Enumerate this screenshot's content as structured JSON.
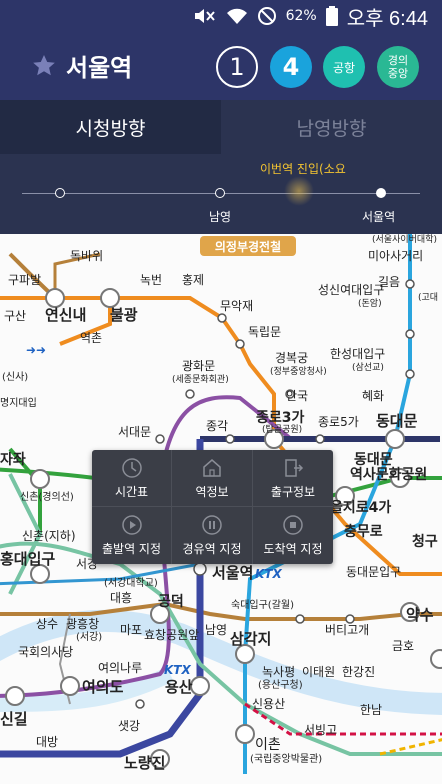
{
  "status_bar": {
    "battery": "62%",
    "time": "오후 6:44",
    "icons": [
      "mute-icon",
      "wifi-icon",
      "do-not-disturb-icon",
      "battery-icon"
    ]
  },
  "header": {
    "station": "서울역",
    "favorite_icon": "star-icon",
    "lines": [
      {
        "label": "1",
        "color": "#2d3568"
      },
      {
        "label": "4",
        "color": "#1aa3dc"
      },
      {
        "label": "공항",
        "color": "#1fc0b0"
      },
      {
        "label": "경의중앙",
        "color": "#2ab894"
      }
    ]
  },
  "direction_tabs": [
    {
      "label": "시청방향",
      "active": true
    },
    {
      "label": "남영방향",
      "active": false
    }
  ],
  "track": {
    "approach_text": "이번역 진입(소요",
    "stations": [
      "남영",
      "서울역"
    ]
  },
  "map": {
    "banner": "의정부경전철",
    "labels": {
      "dokbawi": "독바위",
      "gupabal": "구파발",
      "nokbeon": "녹번",
      "hongje": "홍제",
      "yeonsinnae": "연신내",
      "bulgwang": "불광",
      "gusan": "구산",
      "yeokchon": "역촌",
      "muakjae": "무악재",
      "dongnimmun": "독립문",
      "gwanghwamun": "광화문",
      "gwanghwamun_sub": "(세종문화회관)",
      "gyeongbokgung": "경복궁",
      "gyeongbokgung_sub": "(정부중앙청사)",
      "anguk": "안국",
      "seongsin": "성신여대입구",
      "seongsin_sub": "(돈암)",
      "hansung": "한성대입구",
      "hansung_sub": "(삼선교)",
      "hyehwa": "혜화",
      "dongdaemun": "동대문",
      "jongno3": "종로3가",
      "jongno3_sub": "(탑골공원)",
      "jongno5": "종로5가",
      "jonggak": "종각",
      "seodaemun": "서대문",
      "ddp": "역사문화공원",
      "euljiro4": "을지로4가",
      "chungmuro": "충무로",
      "cheonggu": "청구",
      "dongdaemun_ip": "동대문입구",
      "yaksu": "약수",
      "geumho": "금호",
      "sinchon_gyeongui": "신촌(경의선)",
      "sinchon_jihe": "신촌(지하)",
      "hongdae": "홍대입구",
      "seogang": "서강",
      "seogangdae": "서강대",
      "seogang_daehak": "(서강대학교)",
      "daeheung": "대흥",
      "gongdeok": "공덕",
      "seoulyeok": "서울역",
      "sukdae": "숙대입구(갈월)",
      "sangsu": "상수",
      "gwangheungchang": "광흥창",
      "gwangheungchang_sub": "(서강)",
      "mapo": "마포",
      "hyochang": "효창공원앞",
      "namyeong": "남영",
      "samgakji": "삼각지",
      "beotigogae": "버티고개",
      "gukhoe": "국회의사당",
      "yeouinaru": "여의나루",
      "yeouido": "여의도",
      "yongsan": "용산",
      "noksapyeong": "녹사평",
      "noksapyeong_sub": "(용산구청)",
      "itaewon": "이태원",
      "hangangjin": "한강진",
      "sinyongsan": "신용산",
      "hannam": "한남",
      "singil": "신길",
      "saetgang": "샛강",
      "daebang": "대방",
      "noryangjin": "노량진",
      "ichon": "이촌",
      "ichon_sub": "(국립중앙박물관)",
      "seobinggo": "서빙고",
      "suyu_univ": "(서울사이버대학)",
      "miasageori": "미아사거리",
      "gireum": "길음",
      "godae": "(고대",
      "jaeja": "자좌",
      "gusan_sub": "(신사)",
      "sinsa_sub": "(신사)",
      "jeungsan_sub": "명지대입"
    }
  },
  "popup_menu": [
    {
      "label": "시간표",
      "icon": "clock-icon"
    },
    {
      "label": "역정보",
      "icon": "home-icon"
    },
    {
      "label": "출구정보",
      "icon": "exit-door-icon"
    },
    {
      "label": "출발역 지정",
      "icon": "play-circle-icon"
    },
    {
      "label": "경유역 지정",
      "icon": "pause-circle-icon"
    },
    {
      "label": "도착역 지정",
      "icon": "stop-circle-icon"
    }
  ]
}
